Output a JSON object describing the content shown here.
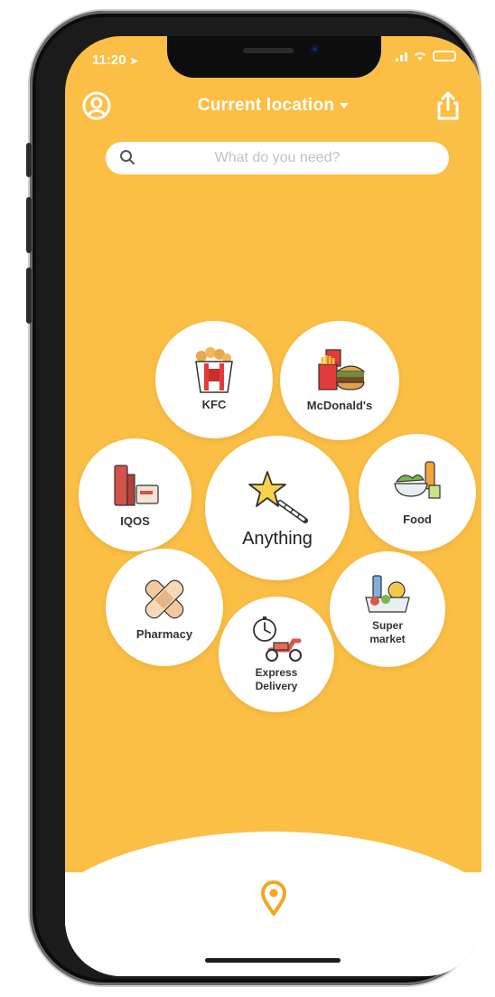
{
  "status_bar": {
    "time": "11:20"
  },
  "header": {
    "location_label": "Current location"
  },
  "search": {
    "placeholder": "What do you need?"
  },
  "categories": {
    "kfc": "KFC",
    "mcdonalds": "McDonald's",
    "iqos": "IQOS",
    "anything": "Anything",
    "food": "Food",
    "pharmacy": "Pharmacy",
    "supermarket_line1": "Super",
    "supermarket_line2": "market",
    "express_line1": "Express",
    "express_line2": "Delivery"
  },
  "icons": [
    "profile-icon",
    "share-icon",
    "search-icon",
    "location-pin-icon",
    "magic-wand-icon"
  ],
  "colors": {
    "background": "#fbbf45",
    "accent": "#f5a623",
    "bubble": "#ffffff"
  }
}
